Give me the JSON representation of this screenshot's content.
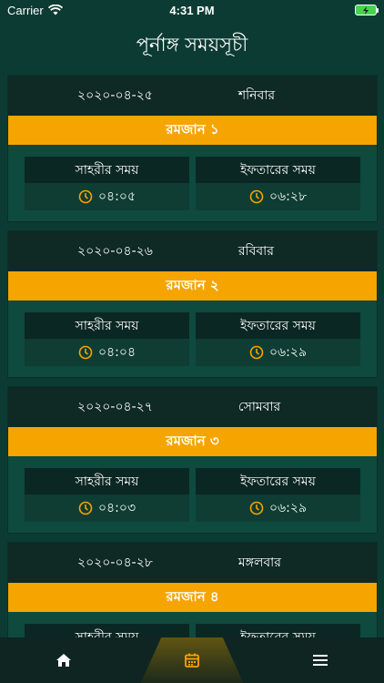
{
  "status": {
    "carrier": "Carrier",
    "time": "4:31 PM"
  },
  "header": {
    "title": "পূর্নাঙ্গ সময়সূচী"
  },
  "days": [
    {
      "date": "২০২০-০৪-২৫",
      "weekday": "শনিবার",
      "ramadan": "রমজান ১",
      "sehri_label": "সাহরীর সময়",
      "sehri_time": "০৪:০৫",
      "iftar_label": "ইফতারের সময়",
      "iftar_time": "০৬:২৮"
    },
    {
      "date": "২০২০-০৪-২৬",
      "weekday": "রবিবার",
      "ramadan": "রমজান ২",
      "sehri_label": "সাহরীর সময়",
      "sehri_time": "০৪:০৪",
      "iftar_label": "ইফতারের সময়",
      "iftar_time": "০৬:২৯"
    },
    {
      "date": "২০২০-০৪-২৭",
      "weekday": "সোমবার",
      "ramadan": "রমজান ৩",
      "sehri_label": "সাহরীর সময়",
      "sehri_time": "০৪:০৩",
      "iftar_label": "ইফতারের সময়",
      "iftar_time": "০৬:২৯"
    },
    {
      "date": "২০২০-০৪-২৮",
      "weekday": "মঙ্গলবার",
      "ramadan": "রমজান ৪",
      "sehri_label": "সাহরীর সময়",
      "sehri_time": "",
      "iftar_label": "ইফতারের সময়",
      "iftar_time": ""
    }
  ],
  "tabbar": {
    "items": [
      {
        "icon": "home-icon"
      },
      {
        "icon": "calendar-icon",
        "active": true
      },
      {
        "icon": "menu-icon"
      }
    ]
  },
  "colors": {
    "accent": "#f5a400",
    "background": "#0c3b33",
    "card_header": "#0f2925"
  }
}
